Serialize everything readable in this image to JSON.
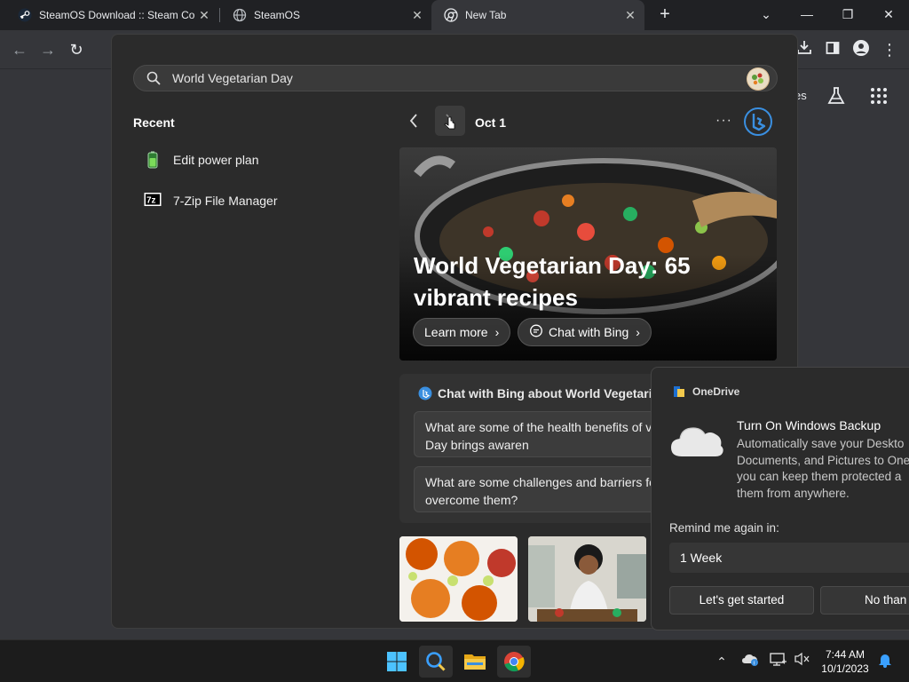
{
  "browser": {
    "tabs": [
      {
        "title": "SteamOS Download :: Steam Cor",
        "favicon": "steam-icon"
      },
      {
        "title": "SteamOS",
        "favicon": "globe-icon"
      },
      {
        "title": "New Tab",
        "favicon": "chrome-icon",
        "active": true
      }
    ],
    "new_tab_label": "+",
    "window_controls": {
      "chevron": "⌄",
      "minimize": "—",
      "restore": "❐",
      "close": "✕"
    },
    "ntp_partial_text": "es"
  },
  "search": {
    "query": "World Vegetarian Day",
    "recent_heading": "Recent",
    "recent_items": [
      {
        "label": "Edit power plan",
        "icon": "battery-icon"
      },
      {
        "label": "7-Zip File Manager",
        "icon": "7zip-icon"
      }
    ],
    "date_label": "Oct 1",
    "more_label": "···",
    "hero": {
      "title": "World Vegetarian Day: 65 vibrant recipes",
      "learn_more": "Learn more",
      "chat_with_bing": "Chat with Bing"
    },
    "chat_card": {
      "heading": "Chat with Bing about World Vegetaria",
      "questions": [
        "What are some of the health benefits of v that World Vegetarian Day brings awaren",
        "What are some challenges and barriers fo and how can they overcome them?"
      ]
    }
  },
  "toast": {
    "app_name": "OneDrive",
    "title": "Turn On Windows Backup",
    "body_lines": [
      "Automatically save your Deskto",
      "Documents, and Pictures to One",
      "you can keep them protected a",
      "them from anywhere."
    ],
    "remind_label": "Remind me again in:",
    "remind_value": "1 Week",
    "primary_button": "Let's get started",
    "secondary_button": "No than"
  },
  "taskbar": {
    "time": "7:44 AM",
    "date": "10/1/2023"
  },
  "colors": {
    "accent_blue": "#3a8fe0",
    "flyout_bg": "#2b2b2b",
    "taskbar_bg": "#1c1c1c"
  }
}
